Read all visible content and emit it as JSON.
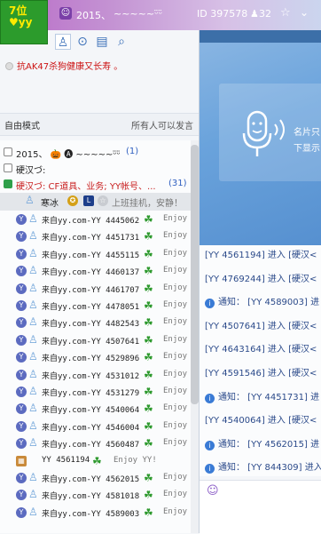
{
  "badge": {
    "line1": "7位",
    "line2": "♥yy"
  },
  "topbar": {
    "channel_name": "2015、",
    "decoration": "~~~~~ᵕ̈ᵕ̈",
    "id_label": "ID 397578",
    "online_count": "32"
  },
  "notice": {
    "text": "抗AK47杀狗健康又长寿 。"
  },
  "mode": {
    "label": "自由模式",
    "right_text": "所有人可以发言"
  },
  "tree": {
    "root": {
      "text": "2015、 🎃 🅐 ~~~~~ᵕ̈ᵕ̈",
      "count": "(1)"
    },
    "group": {
      "text": "硬汉づ:"
    },
    "sub": {
      "text": "硬汉づ: CF道具、业务; YY帐号、...",
      "count": "(31)"
    },
    "vip": {
      "name": "寒冰",
      "extra": "上班挂机，安静！"
    },
    "users": [
      {
        "name": "来自yy.com-YY 4445062",
        "status": "Enjoy"
      },
      {
        "name": "来自yy.com-YY 4451731",
        "status": "Enjoy"
      },
      {
        "name": "来自yy.com-YY 4455115",
        "status": "Enjoy"
      },
      {
        "name": "来自yy.com-YY 4460137",
        "status": "Enjoy"
      },
      {
        "name": "来自yy.com-YY 4461707",
        "status": "Enjoy"
      },
      {
        "name": "来自yy.com-YY 4478051",
        "status": "Enjoy"
      },
      {
        "name": "来自yy.com-YY 4482543",
        "status": "Enjoy"
      },
      {
        "name": "来自yy.com-YY 4507641",
        "status": "Enjoy"
      },
      {
        "name": "来自yy.com-YY 4529896",
        "status": "Enjoy"
      },
      {
        "name": "来自yy.com-YY 4531012",
        "status": "Enjoy"
      },
      {
        "name": "来自yy.com-YY 4531279",
        "status": "Enjoy"
      },
      {
        "name": "来自yy.com-YY 4540064",
        "status": "Enjoy"
      },
      {
        "name": "来自yy.com-YY 4546004",
        "status": "Enjoy"
      },
      {
        "name": "来自yy.com-YY 4560487",
        "status": "Enjoy"
      },
      {
        "name": "YY 4561194",
        "status": "Enjoy YY!"
      },
      {
        "name": "来自yy.com-YY 4562015",
        "status": "Enjoy"
      },
      {
        "name": "来自yy.com-YY 4581018",
        "status": "Enjoy"
      },
      {
        "name": "来自yy.com-YY 4589003",
        "status": "Enjoy"
      }
    ]
  },
  "video": {
    "line1": "名片只",
    "line2": "下显示"
  },
  "chat": {
    "lines": [
      {
        "text": "[YY 4561194] 进入 [硬汉<",
        "notice": false
      },
      {
        "text": "[YY 4769244] 进入 [硬汉<",
        "notice": false
      },
      {
        "text": "通知： [YY 4589003] 进",
        "notice": true
      },
      {
        "text": "[YY 4507641] 进入 [硬汉<",
        "notice": false
      },
      {
        "text": "[YY 4643164] 进入 [硬汉<",
        "notice": false
      },
      {
        "text": "[YY 4591546] 进入 [硬汉<",
        "notice": false
      },
      {
        "text": "通知： [YY 4451731] 进",
        "notice": true
      },
      {
        "text": "[YY 4540064] 进入 [硬汉<",
        "notice": false
      },
      {
        "text": "通知： [YY 4562015] 进",
        "notice": true
      },
      {
        "text": "通知： [YY 844309] 进入",
        "notice": true
      }
    ]
  }
}
